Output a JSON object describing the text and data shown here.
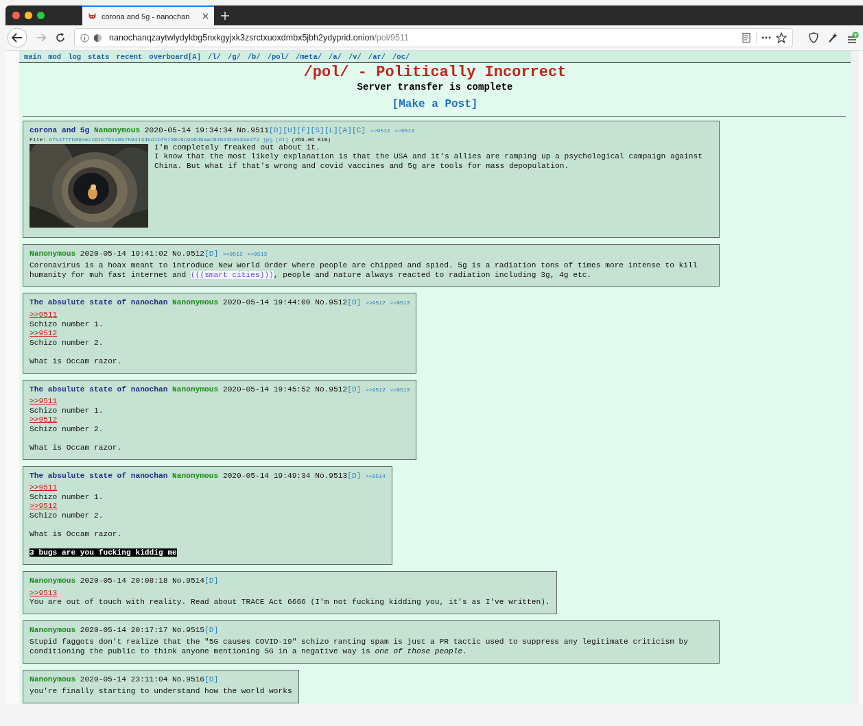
{
  "browser": {
    "tab": {
      "title": "corona and 5g - nanochan",
      "selected": true
    },
    "address": {
      "host": "nanochanqzaytwlydykbg5nxkgyjxk3zsrctxuoxdmbx5jbh2ydyprid.onion",
      "path": "/pol/9511"
    }
  },
  "nav": [
    "main",
    "mod",
    "log",
    "stats",
    "recent",
    "overboard[A]",
    "/l/",
    "/g/",
    "/b/",
    "/pol/",
    "/meta/",
    "/a/",
    "/v/",
    "/ar/",
    "/oc/"
  ],
  "board": {
    "title": "/pol/ - Politically Incorrect",
    "notice": "Server transfer is complete",
    "post_link": "[Make a Post]"
  },
  "posts": [
    {
      "subject": "corona and 5g",
      "name": "Nanonymous",
      "date": "2020-05-14 19:34:34",
      "number": "No.9511",
      "actions": [
        "[D]",
        "[U]",
        "[F]",
        "[S]",
        "[L]",
        "[A]",
        "[C]"
      ],
      "backlinks": [
        ">>9512",
        ">>9513"
      ],
      "file": {
        "label": "File:",
        "name": "6751fffb894ecc61bf914857594134bd1bf5738c6c99649aac92b23b3531e2f2.jpg",
        "dl": "(dl)",
        "size": "(269.06 KiB)"
      },
      "body": [
        {
          "kind": "text",
          "text": "I'm completely freaked out about it."
        },
        {
          "kind": "text",
          "text": "I know that the most likely explanation is that the USA and it's allies are ramping up a psychological campaign against China. But what if that's wrong and covid vaccines and 5g are tools for mass depopulation."
        }
      ]
    },
    {
      "name": "Nanonymous",
      "date": "2020-05-14 19:41:02",
      "number": "No.9512",
      "actions": [
        "[D]"
      ],
      "backlinks": [
        ">>9512",
        ">>9513"
      ],
      "body": [
        {
          "kind": "text",
          "parts": [
            {
              "text": "Coronavirus is a hoax meant to introduce New World Order where people are chipped and spied. 5g is a radiation tons of times more intense to kill humanity for muh fast internet and ",
              "kind": "plain"
            },
            {
              "text": "(((smart cities)))",
              "kind": "highlight"
            },
            {
              "text": ", people and nature always reacted to radiation including 3g, 4g etc.",
              "kind": "plain"
            }
          ]
        }
      ]
    },
    {
      "subject": "The absulute state of nanochan",
      "name": "Nanonymous",
      "date": "2020-05-14 19:44:00",
      "number": "No.9512",
      "actions": [
        "[D]"
      ],
      "backlinks": [
        ">>9512",
        ">>9513"
      ],
      "body": [
        {
          "kind": "quote",
          "text": ">>9511"
        },
        {
          "kind": "text",
          "text": "Schizo number 1."
        },
        {
          "kind": "quote",
          "text": ">>9512"
        },
        {
          "kind": "text",
          "text": "Schizo number 2."
        },
        {
          "kind": "blank"
        },
        {
          "kind": "text",
          "text": "What is Occam razor."
        }
      ]
    },
    {
      "subject": "The absulute state of nanochan",
      "name": "Nanonymous",
      "date": "2020-05-14 19:45:52",
      "number": "No.9512",
      "actions": [
        "[D]"
      ],
      "backlinks": [
        ">>9512",
        ">>9513"
      ],
      "body": [
        {
          "kind": "quote",
          "text": ">>9511"
        },
        {
          "kind": "text",
          "text": "Schizo number 1."
        },
        {
          "kind": "quote",
          "text": ">>9512"
        },
        {
          "kind": "text",
          "text": "Schizo number 2."
        },
        {
          "kind": "blank"
        },
        {
          "kind": "text",
          "text": "What is Occam razor."
        }
      ]
    },
    {
      "subject": "The absulute state of nanochan",
      "name": "Nanonymous",
      "date": "2020-05-14 19:49:34",
      "number": "No.9513",
      "actions": [
        "[D]"
      ],
      "backlinks": [
        ">>9514"
      ],
      "body": [
        {
          "kind": "quote",
          "text": ">>9511"
        },
        {
          "kind": "text",
          "text": "Schizo number 1."
        },
        {
          "kind": "quote",
          "text": ">>9512"
        },
        {
          "kind": "text",
          "text": "Schizo number 2."
        },
        {
          "kind": "blank"
        },
        {
          "kind": "text",
          "text": "What is Occam razor."
        },
        {
          "kind": "blank"
        },
        {
          "kind": "spoiler",
          "text": "3 bugs are you fucking kiddig me"
        }
      ]
    },
    {
      "name": "Nanonymous",
      "date": "2020-05-14 20:08:18",
      "number": "No.9514",
      "actions": [
        "[D]"
      ],
      "body": [
        {
          "kind": "quote",
          "text": ">>9513"
        },
        {
          "kind": "text",
          "text": "You are out of touch with reality. Read about TRACE Act 6666 (I'm not fucking kidding you, it's as I've written)."
        }
      ]
    },
    {
      "name": "Nanonymous",
      "date": "2020-05-14 20:17:17",
      "number": "No.9515",
      "actions": [
        "[D]"
      ],
      "body": [
        {
          "kind": "text",
          "text": "Stupid faggots don't realize that the \"5G causes COVID-19\" schizo ranting spam is just a PR tactic used to suppress any legitimate criticism by conditioning the public to think anyone mentioning 5G in a negative way is *one of those people*."
        }
      ]
    },
    {
      "name": "Nanonymous",
      "date": "2020-05-14 23:11:04",
      "number": "No.9516",
      "actions": [
        "[D]"
      ],
      "body": [
        {
          "kind": "text",
          "text": "you're finally starting to understand how the world works"
        }
      ]
    }
  ]
}
